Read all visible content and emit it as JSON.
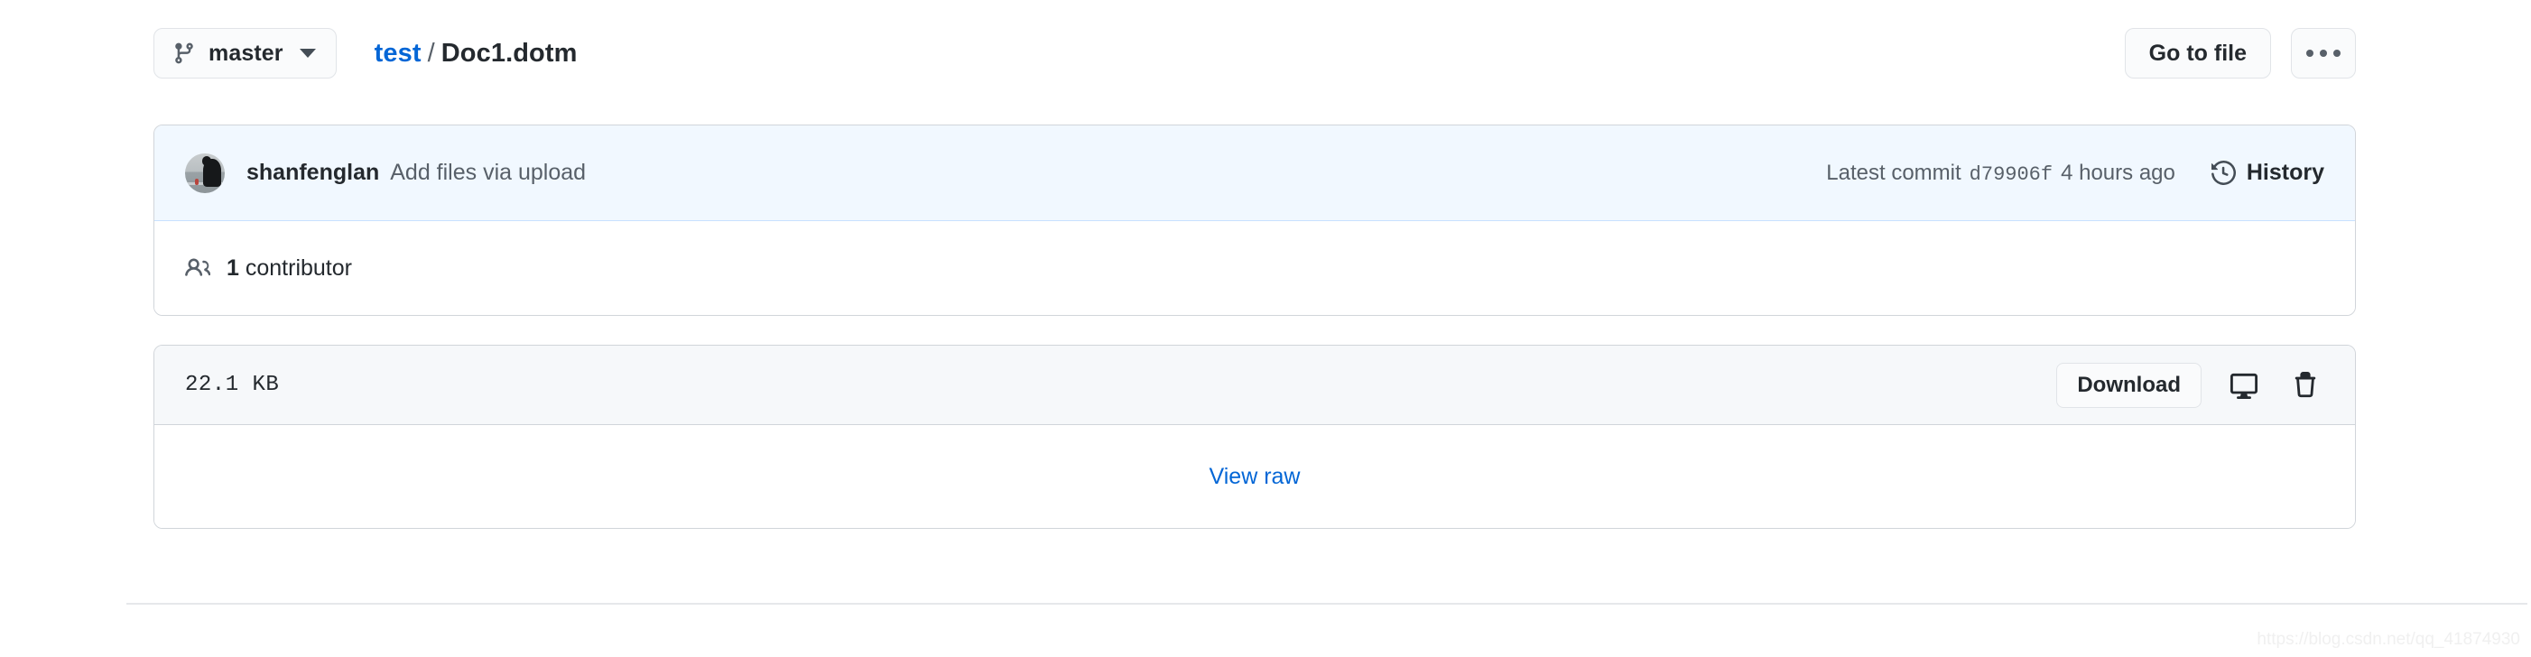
{
  "toolbar": {
    "branch_icon": "git-branch-icon",
    "branch_name": "master",
    "caret_icon": "chevron-down-icon",
    "breadcrumb": {
      "repo": "test",
      "separator": "/",
      "file": "Doc1.dotm"
    },
    "go_to_file_label": "Go to file",
    "kebab_icon": "kebab-horizontal-icon"
  },
  "commit": {
    "avatar_alt": "shanfenglan",
    "author": "shanfenglan",
    "message": "Add files via upload",
    "latest_commit_label": "Latest commit",
    "sha": "d79906f",
    "relative_time": "4 hours ago",
    "history_label": "History",
    "history_icon": "history-icon"
  },
  "contributors": {
    "icon": "people-icon",
    "count": "1",
    "label": "contributor"
  },
  "file": {
    "size": "22.1 KB",
    "download_label": "Download",
    "desktop_icon": "device-desktop-icon",
    "delete_icon": "trash-icon",
    "view_raw_label": "View raw"
  },
  "watermark": "https://blog.csdn.net/qq_41874930",
  "colors": {
    "link": "#0366d6",
    "commit_bg": "#f1f8ff",
    "commit_border": "#c8e1ff",
    "panel_border": "#d1d5da",
    "header_bg": "#f6f8fa",
    "text": "#24292e",
    "muted": "#586069"
  }
}
